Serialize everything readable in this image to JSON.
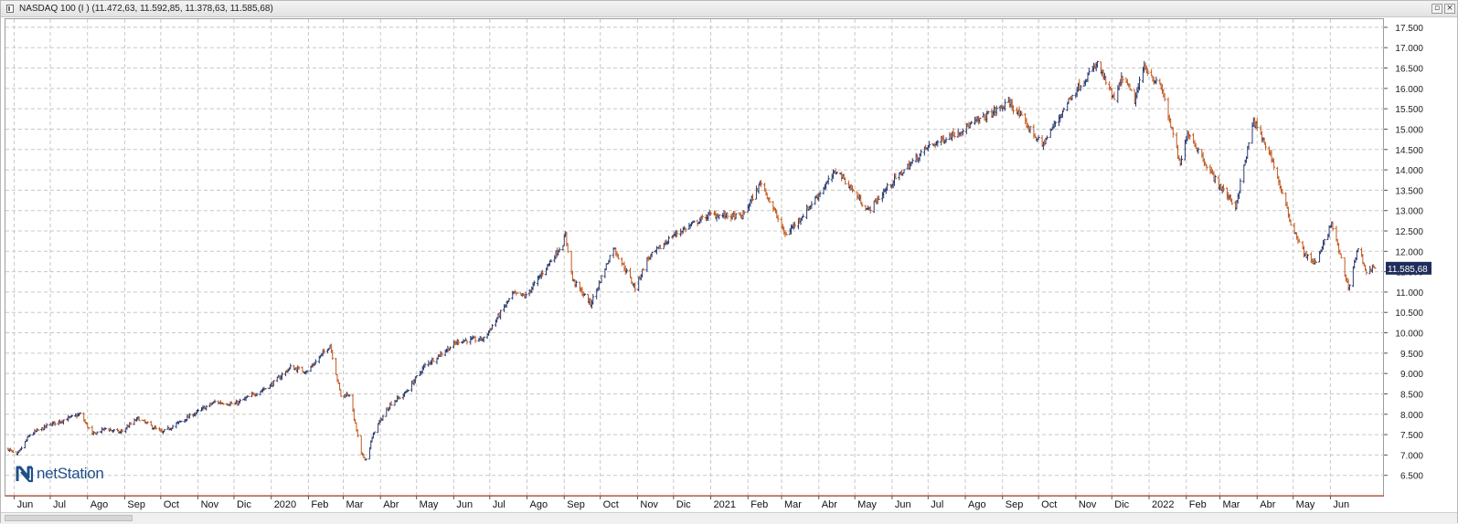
{
  "window": {
    "title": "NASDAQ 100 (I ) (11.472,63, 11.592,85, 11.378,63, 11.585,68)",
    "restore_glyph": "▫",
    "close_glyph": "×"
  },
  "logo": {
    "text": "netStation",
    "icon": "netstation-n-logo"
  },
  "colors": {
    "up_bar": "#2b3a6e",
    "down_bar": "#c0581e",
    "grid": "#c8c8c8",
    "price_badge": "#1f2d5c",
    "axis_line": "#9c9c9c"
  },
  "chart_data": {
    "type": "ohlc",
    "title": "NASDAQ 100 (I ) (11.472,63, 11.592,85, 11.378,63, 11.585,68)",
    "last_price_label": "11.585,68",
    "grid": true,
    "y_axis_side": "right",
    "ylim": [
      6000,
      17700
    ],
    "y_ticks": [
      6500,
      7000,
      7500,
      8000,
      8500,
      9000,
      9500,
      10000,
      10500,
      11000,
      11500,
      12000,
      12500,
      13000,
      13500,
      14000,
      14500,
      15000,
      15500,
      16000,
      16500,
      17000,
      17500
    ],
    "y_tick_labels": [
      "6.500",
      "7.000",
      "7.500",
      "8.000",
      "8.500",
      "9.000",
      "9.500",
      "10.000",
      "10.500",
      "11.000",
      "11.500",
      "12.000",
      "12.500",
      "13.000",
      "13.500",
      "14.000",
      "14.500",
      "15.000",
      "15.500",
      "16.000",
      "16.500",
      "17.000",
      "17.500"
    ],
    "x_range": [
      "2019-05-27",
      "2022-07-08"
    ],
    "x_ticks": [
      {
        "label": "Jun",
        "date": "2019-06-01"
      },
      {
        "label": "Jul",
        "date": "2019-07-01"
      },
      {
        "label": "Ago",
        "date": "2019-08-01"
      },
      {
        "label": "Sep",
        "date": "2019-09-01"
      },
      {
        "label": "Oct",
        "date": "2019-10-01"
      },
      {
        "label": "Nov",
        "date": "2019-11-01"
      },
      {
        "label": "Dic",
        "date": "2019-12-01"
      },
      {
        "label": "2020",
        "date": "2020-01-01"
      },
      {
        "label": "Feb",
        "date": "2020-02-01"
      },
      {
        "label": "Mar",
        "date": "2020-03-01"
      },
      {
        "label": "Abr",
        "date": "2020-04-01"
      },
      {
        "label": "May",
        "date": "2020-05-01"
      },
      {
        "label": "Jun",
        "date": "2020-06-01"
      },
      {
        "label": "Jul",
        "date": "2020-07-01"
      },
      {
        "label": "Ago",
        "date": "2020-08-01"
      },
      {
        "label": "Sep",
        "date": "2020-09-01"
      },
      {
        "label": "Oct",
        "date": "2020-10-01"
      },
      {
        "label": "Nov",
        "date": "2020-11-01"
      },
      {
        "label": "Dic",
        "date": "2020-12-01"
      },
      {
        "label": "2021",
        "date": "2021-01-01"
      },
      {
        "label": "Feb",
        "date": "2021-02-01"
      },
      {
        "label": "Mar",
        "date": "2021-03-01"
      },
      {
        "label": "Abr",
        "date": "2021-04-01"
      },
      {
        "label": "May",
        "date": "2021-05-01"
      },
      {
        "label": "Jun",
        "date": "2021-06-01"
      },
      {
        "label": "Jul",
        "date": "2021-07-01"
      },
      {
        "label": "Ago",
        "date": "2021-08-01"
      },
      {
        "label": "Sep",
        "date": "2021-09-01"
      },
      {
        "label": "Oct",
        "date": "2021-10-01"
      },
      {
        "label": "Nov",
        "date": "2021-11-01"
      },
      {
        "label": "Dic",
        "date": "2021-12-01"
      },
      {
        "label": "2022",
        "date": "2022-01-01"
      },
      {
        "label": "Feb",
        "date": "2022-02-01"
      },
      {
        "label": "Mar",
        "date": "2022-03-01"
      },
      {
        "label": "Abr",
        "date": "2022-04-01"
      },
      {
        "label": "May",
        "date": "2022-05-01"
      },
      {
        "label": "Jun",
        "date": "2022-06-01"
      }
    ],
    "close_path": [
      {
        "date": "2019-05-27",
        "close": 7150
      },
      {
        "date": "2019-06-03",
        "close": 6980
      },
      {
        "date": "2019-06-14",
        "close": 7500
      },
      {
        "date": "2019-07-01",
        "close": 7750
      },
      {
        "date": "2019-07-26",
        "close": 8000
      },
      {
        "date": "2019-08-05",
        "close": 7500
      },
      {
        "date": "2019-08-16",
        "close": 7650
      },
      {
        "date": "2019-08-28",
        "close": 7550
      },
      {
        "date": "2019-09-12",
        "close": 7900
      },
      {
        "date": "2019-10-02",
        "close": 7550
      },
      {
        "date": "2019-10-25",
        "close": 7950
      },
      {
        "date": "2019-11-15",
        "close": 8300
      },
      {
        "date": "2019-12-02",
        "close": 8250
      },
      {
        "date": "2019-12-31",
        "close": 8700
      },
      {
        "date": "2020-01-17",
        "close": 9150
      },
      {
        "date": "2020-01-31",
        "close": 9050
      },
      {
        "date": "2020-02-19",
        "close": 9700
      },
      {
        "date": "2020-02-28",
        "close": 8450
      },
      {
        "date": "2020-03-06",
        "close": 8500
      },
      {
        "date": "2020-03-12",
        "close": 7600
      },
      {
        "date": "2020-03-16",
        "close": 7000
      },
      {
        "date": "2020-03-20",
        "close": 6900
      },
      {
        "date": "2020-03-27",
        "close": 7600
      },
      {
        "date": "2020-04-09",
        "close": 8250
      },
      {
        "date": "2020-04-21",
        "close": 8500
      },
      {
        "date": "2020-05-08",
        "close": 9200
      },
      {
        "date": "2020-06-05",
        "close": 9800
      },
      {
        "date": "2020-06-26",
        "close": 9850
      },
      {
        "date": "2020-07-20",
        "close": 10950
      },
      {
        "date": "2020-07-31",
        "close": 10900
      },
      {
        "date": "2020-08-31",
        "close": 12200
      },
      {
        "date": "2020-09-02",
        "close": 12400
      },
      {
        "date": "2020-09-08",
        "close": 11300
      },
      {
        "date": "2020-09-23",
        "close": 10700
      },
      {
        "date": "2020-10-12",
        "close": 12100
      },
      {
        "date": "2020-10-30",
        "close": 11100
      },
      {
        "date": "2020-11-09",
        "close": 11800
      },
      {
        "date": "2020-12-01",
        "close": 12400
      },
      {
        "date": "2020-12-31",
        "close": 12900
      },
      {
        "date": "2021-01-27",
        "close": 12850
      },
      {
        "date": "2021-02-12",
        "close": 13700
      },
      {
        "date": "2021-03-04",
        "close": 12400
      },
      {
        "date": "2021-03-19",
        "close": 12900
      },
      {
        "date": "2021-04-16",
        "close": 14000
      },
      {
        "date": "2021-05-12",
        "close": 13000
      },
      {
        "date": "2021-06-01",
        "close": 13700
      },
      {
        "date": "2021-06-30",
        "close": 14550
      },
      {
        "date": "2021-07-30",
        "close": 15000
      },
      {
        "date": "2021-09-07",
        "close": 15650
      },
      {
        "date": "2021-10-04",
        "close": 14600
      },
      {
        "date": "2021-10-29",
        "close": 15850
      },
      {
        "date": "2021-11-19",
        "close": 16600
      },
      {
        "date": "2021-12-03",
        "close": 15700
      },
      {
        "date": "2021-12-10",
        "close": 16300
      },
      {
        "date": "2021-12-20",
        "close": 15700
      },
      {
        "date": "2021-12-28",
        "close": 16550
      },
      {
        "date": "2022-01-12",
        "close": 15950
      },
      {
        "date": "2022-01-27",
        "close": 14100
      },
      {
        "date": "2022-02-02",
        "close": 14950
      },
      {
        "date": "2022-02-24",
        "close": 13800
      },
      {
        "date": "2022-03-14",
        "close": 13100
      },
      {
        "date": "2022-03-29",
        "close": 15200
      },
      {
        "date": "2022-04-13",
        "close": 14300
      },
      {
        "date": "2022-04-29",
        "close": 12700
      },
      {
        "date": "2022-05-11",
        "close": 11900
      },
      {
        "date": "2022-05-20",
        "close": 11700
      },
      {
        "date": "2022-06-02",
        "close": 12700
      },
      {
        "date": "2022-06-16",
        "close": 11100
      },
      {
        "date": "2022-06-24",
        "close": 12100
      },
      {
        "date": "2022-07-01",
        "close": 11500
      },
      {
        "date": "2022-07-08",
        "close": 11585
      }
    ]
  }
}
